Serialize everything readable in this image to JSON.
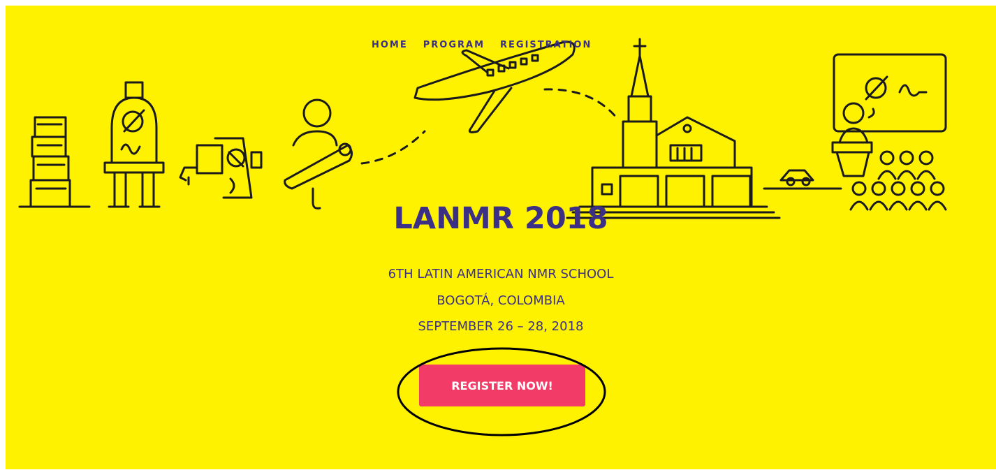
{
  "nav": {
    "items": [
      {
        "label": "HOME"
      },
      {
        "label": "PROGRAM"
      },
      {
        "label": "REGISTRATION"
      }
    ]
  },
  "hero": {
    "title": "LANMR 2018",
    "subtitle_line1": "6TH LATIN AMERICAN NMR SCHOOL",
    "subtitle_line2": "BOGOTÁ, COLOMBIA",
    "subtitle_line3": "SEPTEMBER 26 – 28, 2018",
    "cta_label": "REGISTER NOW!"
  },
  "colors": {
    "background": "#fff200",
    "text": "#3b2f86",
    "cta": "#f23b66",
    "illustration_stroke": "#1a1a1a"
  }
}
